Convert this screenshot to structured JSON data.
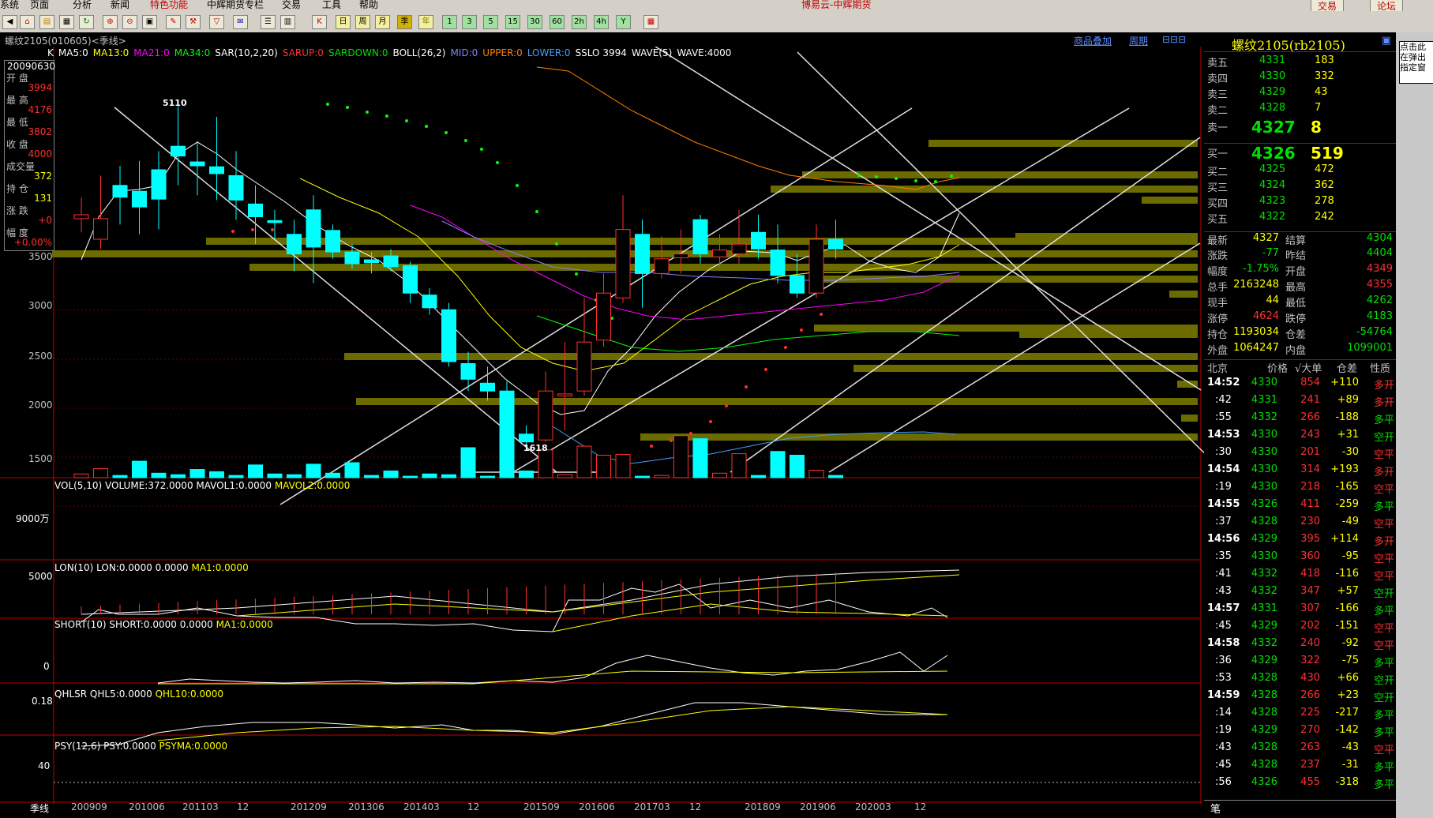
{
  "menu": {
    "items": [
      "系统",
      "页面",
      "分析",
      "新闻",
      "特色功能",
      "中辉期货专栏",
      "交易",
      "工具",
      "帮助"
    ],
    "title": "博易云-中辉期货",
    "trade": "交易",
    "forum": "论坛"
  },
  "toolbar": {
    "icons": [
      "home-icon",
      "folder-icon",
      "refresh-icon",
      "zoom-in-icon",
      "zoom-out-icon",
      "window-icon",
      "pen-icon",
      "filter-icon",
      "tool-icon",
      "news-icon",
      "table-icon",
      "chart-icon",
      "k-icon",
      "period-icon"
    ],
    "periods": [
      "日",
      "周",
      "月",
      "季",
      "年",
      "1",
      "3",
      "5",
      "15",
      "30",
      "60",
      "2h",
      "4h",
      "Y"
    ]
  },
  "header": {
    "symbol": "螺纹2105(010605)<季线>",
    "goods_add": "商品叠加",
    "period": "周期"
  },
  "legend": {
    "k": "K",
    "ma5": "MA5:0",
    "ma13": "MA13:0",
    "ma21": "MA21:0",
    "ma34": "MA34:0",
    "sar": "SAR(10,2,20)",
    "sarup": "SARUP:0",
    "sardown": "SARDOWN:0",
    "boll": "BOLL(26,2)",
    "mid": "MID:0",
    "upper": "UPPER:0",
    "lower": "LOWER:0",
    "sslo": "SSLO 3994",
    "wave": "WAVE(5)",
    "waveval": "WAVE:4000"
  },
  "infobox": {
    "date": "20090630",
    "open_l": "开 盘",
    "open": "3994",
    "high_l": "最 高",
    "high": "4176",
    "low_l": "最 低",
    "low": "3802",
    "close_l": "收 盘",
    "close": "4000",
    "vol_l": "成交量",
    "vol": "372",
    "oi_l": "持 仓",
    "oi": "131",
    "chg_l": "涨 跌",
    "chg": "+0",
    "amp_l": "幅 度",
    "amp": "+0.00%"
  },
  "price_axis": [
    "3500",
    "3000",
    "2500",
    "2000",
    "1500"
  ],
  "chart_marks": {
    "high": "5110",
    "low": "1618"
  },
  "vol": {
    "legend": "VOL(5,10) VOLUME:372.0000 MAVOL1:0.0000",
    "mavol2": "MAVOL2:0.0000",
    "axis": "9000万"
  },
  "lon": {
    "legend": "LON(10) LON:0.0000 0.0000",
    "ma1": "MA1:0.0000",
    "axis": "5000"
  },
  "short": {
    "legend": "SHORT(10) SHORT:0.0000 0.0000",
    "ma1": "MA1:0.0000",
    "axis": "0"
  },
  "qhlsr": {
    "legend": "QHLSR QHL5:0.0000",
    "qhl10": "QHL10:0.0000",
    "axis": "0.18"
  },
  "psy": {
    "legend": "PSY(12,6) PSY:0.0000",
    "psyma": "PSYMA:0.0000",
    "axis": "40"
  },
  "date_axis": {
    "label": "季线",
    "ticks": [
      "200909",
      "201006",
      "201103",
      "12",
      "201209",
      "201306",
      "201403",
      "12",
      "201509",
      "201606",
      "201703",
      "12",
      "201809",
      "201906",
      "202003",
      "12"
    ]
  },
  "quote": {
    "title": "螺纹2105(rb2105)",
    "asks": [
      [
        "卖五",
        "4331",
        "183"
      ],
      [
        "卖四",
        "4330",
        "332"
      ],
      [
        "卖三",
        "4329",
        "43"
      ],
      [
        "卖二",
        "4328",
        "7"
      ],
      [
        "卖一",
        "4327",
        "8"
      ]
    ],
    "bids": [
      [
        "买一",
        "4326",
        "519"
      ],
      [
        "买二",
        "4325",
        "472"
      ],
      [
        "买三",
        "4324",
        "362"
      ],
      [
        "买四",
        "4323",
        "278"
      ],
      [
        "买五",
        "4322",
        "242"
      ]
    ],
    "stats": [
      [
        "最新",
        "4327",
        "结算",
        "4304"
      ],
      [
        "涨跌",
        "-77",
        "昨结",
        "4404"
      ],
      [
        "幅度",
        "-1.75%",
        "开盘",
        "4349"
      ],
      [
        "总手",
        "2163248",
        "最高",
        "4355"
      ],
      [
        "现手",
        "44",
        "最低",
        "4262"
      ],
      [
        "涨停",
        "4624",
        "跌停",
        "4183"
      ],
      [
        "持仓",
        "1193034",
        "仓差",
        "-54764"
      ],
      [
        "外盘",
        "1064247",
        "内盘",
        "1099001"
      ]
    ],
    "tick_header": [
      "北京",
      "价格",
      "√大单",
      "仓差",
      "性质"
    ],
    "ticks": [
      [
        "14:52",
        "4330",
        "854",
        "+110",
        "多开"
      ],
      [
        ":42",
        "4331",
        "241",
        "+89",
        "多开"
      ],
      [
        ":55",
        "4332",
        "266",
        "-188",
        "多平"
      ],
      [
        "14:53",
        "4330",
        "243",
        "+31",
        "空开"
      ],
      [
        ":30",
        "4330",
        "201",
        "-30",
        "空平"
      ],
      [
        "14:54",
        "4330",
        "314",
        "+193",
        "多开"
      ],
      [
        ":19",
        "4330",
        "218",
        "-165",
        "空平"
      ],
      [
        "14:55",
        "4326",
        "411",
        "-259",
        "多平"
      ],
      [
        ":37",
        "4328",
        "230",
        "-49",
        "空平"
      ],
      [
        "14:56",
        "4329",
        "395",
        "+114",
        "多开"
      ],
      [
        ":35",
        "4330",
        "360",
        "-95",
        "空平"
      ],
      [
        ":41",
        "4332",
        "418",
        "-116",
        "空平"
      ],
      [
        ":43",
        "4332",
        "347",
        "+57",
        "空开"
      ],
      [
        "14:57",
        "4331",
        "307",
        "-166",
        "多平"
      ],
      [
        ":45",
        "4329",
        "202",
        "-151",
        "空平"
      ],
      [
        "14:58",
        "4332",
        "240",
        "-92",
        "空平"
      ],
      [
        ":36",
        "4329",
        "322",
        "-75",
        "多平"
      ],
      [
        ":53",
        "4328",
        "430",
        "+66",
        "空开"
      ],
      [
        "14:59",
        "4328",
        "266",
        "+23",
        "空开"
      ],
      [
        ":14",
        "4328",
        "225",
        "-217",
        "多平"
      ],
      [
        ":19",
        "4329",
        "270",
        "-142",
        "多平"
      ],
      [
        ":43",
        "4328",
        "263",
        "-43",
        "空平"
      ],
      [
        ":45",
        "4328",
        "237",
        "-31",
        "多平"
      ],
      [
        ":56",
        "4326",
        "455",
        "-318",
        "多平"
      ]
    ],
    "footer": "笔"
  },
  "popup": "点击此在弹出指定窗"
}
